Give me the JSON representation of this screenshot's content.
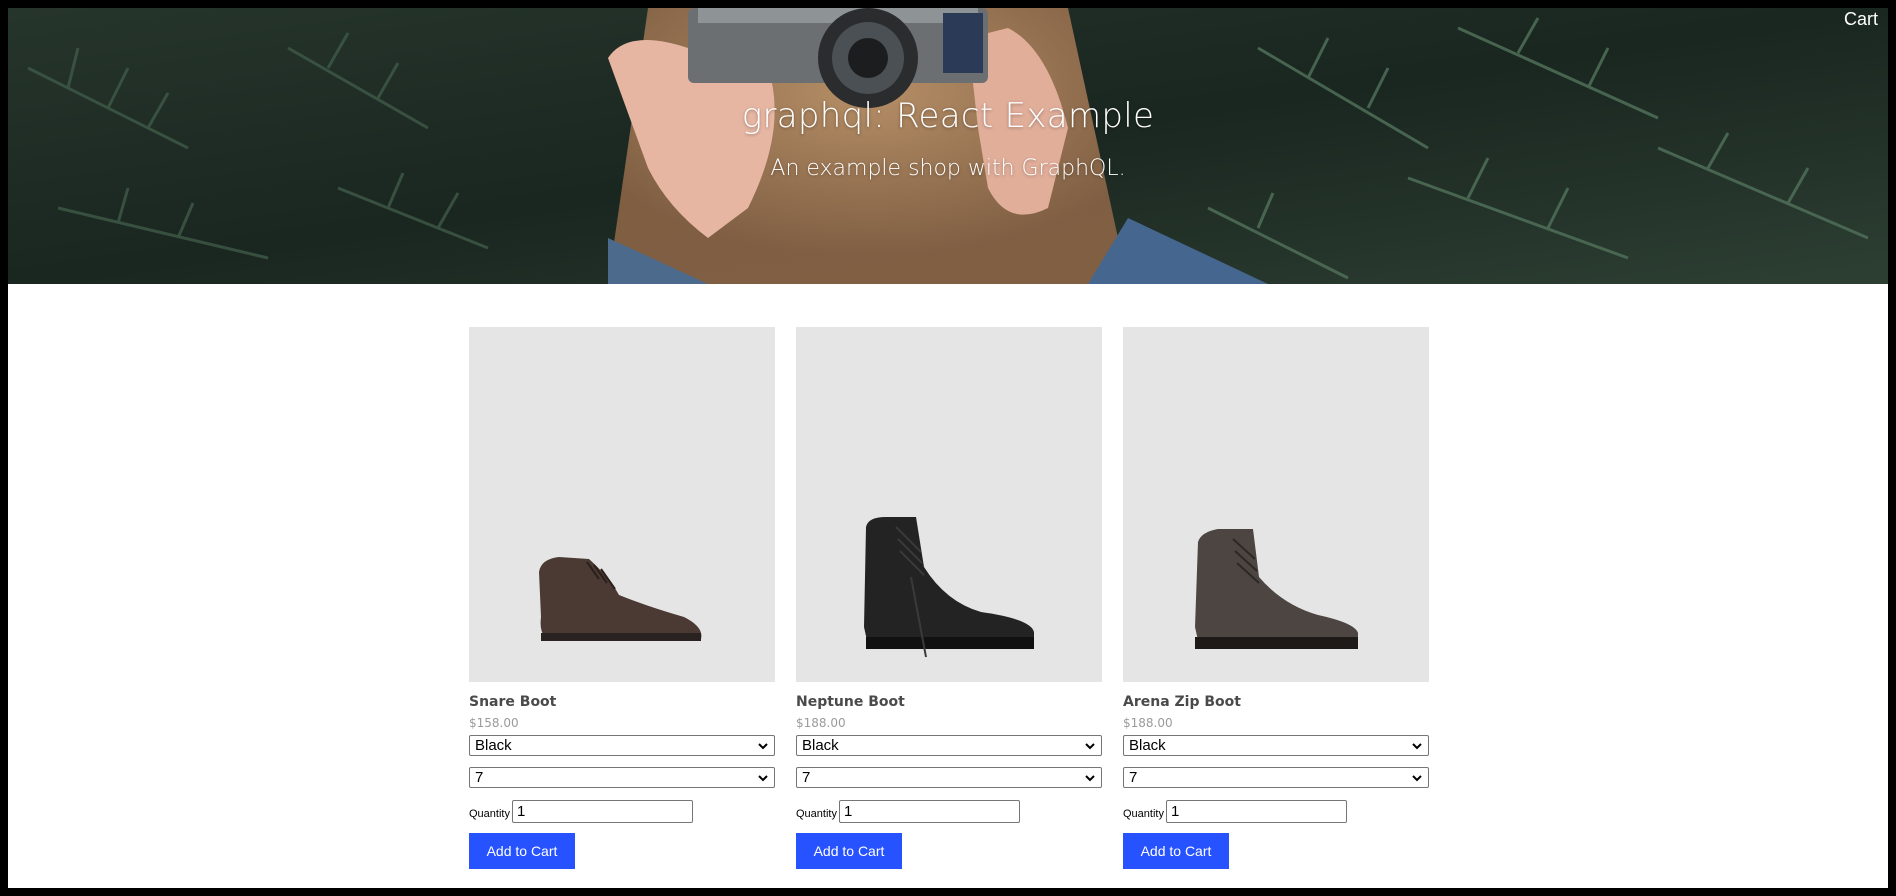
{
  "header": {
    "title": "graphql: React Example",
    "subtitle": "An example shop with GraphQL.",
    "cart_label": "Cart"
  },
  "products": [
    {
      "title": "Snare Boot",
      "price": "$158.00",
      "color": "Black",
      "size": "7",
      "quantity_label": "Quantity",
      "quantity": "1",
      "add_label": "Add to Cart"
    },
    {
      "title": "Neptune Boot",
      "price": "$188.00",
      "color": "Black",
      "size": "7",
      "quantity_label": "Quantity",
      "quantity": "1",
      "add_label": "Add to Cart"
    },
    {
      "title": "Arena Zip Boot",
      "price": "$188.00",
      "color": "Black",
      "size": "7",
      "quantity_label": "Quantity",
      "quantity": "1",
      "add_label": "Add to Cart"
    }
  ],
  "icons": {
    "cart": "cart-link",
    "dropdown": "chevron-down-icon",
    "product_image": "boot-image"
  },
  "colors": {
    "button": "#2752ff",
    "image_bg": "#e5e5e5",
    "title_text": "#4a4a4a",
    "price_text": "#9b9b9b"
  }
}
